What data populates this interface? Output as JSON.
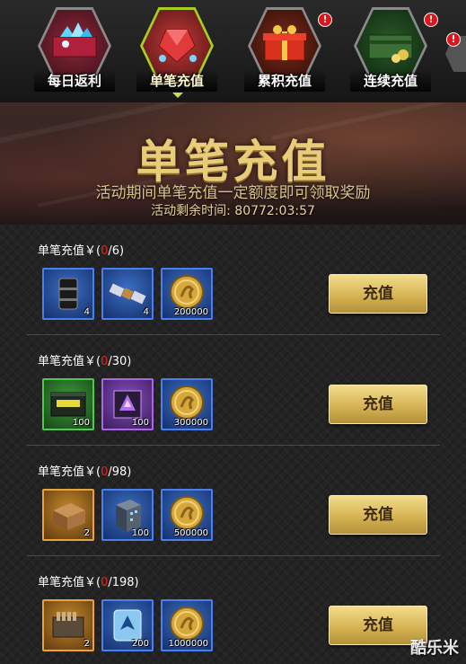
{
  "tabs": [
    {
      "label": "每日返利",
      "badge": "",
      "active": false
    },
    {
      "label": "单笔充值",
      "badge": "",
      "active": true
    },
    {
      "label": "累积充值",
      "badge": "!",
      "active": false
    },
    {
      "label": "连续充值",
      "badge": "!",
      "active": false
    }
  ],
  "extra_badge": "!",
  "banner": {
    "title": "单笔充值",
    "subtitle": "活动期间单笔充值一定额度即可领取奖励",
    "time_label": "活动剩余时间:",
    "time_value": "80772:03:57"
  },
  "rows": [
    {
      "label_prefix": "单笔充值￥(",
      "progress": "0",
      "target": "/6)",
      "button": "充值",
      "items": [
        {
          "icon": "oil-barrel-icon",
          "rarity": "blue",
          "qty": "4"
        },
        {
          "icon": "satellite-icon",
          "rarity": "blue",
          "qty": "4"
        },
        {
          "icon": "gold-coin-icon",
          "rarity": "blue",
          "qty": "200000"
        }
      ]
    },
    {
      "label_prefix": "单笔充值￥(",
      "progress": "0",
      "target": "/30)",
      "button": "充值",
      "items": [
        {
          "icon": "military-crate-icon",
          "rarity": "green",
          "qty": "100"
        },
        {
          "icon": "chip-icon",
          "rarity": "purple",
          "qty": "100"
        },
        {
          "icon": "gold-coin-icon",
          "rarity": "blue",
          "qty": "300000"
        }
      ]
    },
    {
      "label_prefix": "单笔充值￥(",
      "progress": "0",
      "target": "/98)",
      "button": "充值",
      "items": [
        {
          "icon": "leather-box-icon",
          "rarity": "orange",
          "qty": "2"
        },
        {
          "icon": "building-icon",
          "rarity": "blue",
          "qty": "100"
        },
        {
          "icon": "gold-coin-icon",
          "rarity": "blue",
          "qty": "500000"
        }
      ]
    },
    {
      "label_prefix": "单笔充值￥(",
      "progress": "0",
      "target": "/198)",
      "button": "充值",
      "items": [
        {
          "icon": "ammo-crate-icon",
          "rarity": "orange",
          "qty": "2"
        },
        {
          "icon": "crystal-emblem-icon",
          "rarity": "blue",
          "qty": "200"
        },
        {
          "icon": "gold-coin-icon",
          "rarity": "blue",
          "qty": "1000000"
        }
      ]
    }
  ],
  "watermark": "酷乐米",
  "colors": {
    "accent_gold": "#e9cc7a",
    "active_tab": "#a6cf1f",
    "progress_red": "#e0261e",
    "button_gold": "#d6b454"
  }
}
